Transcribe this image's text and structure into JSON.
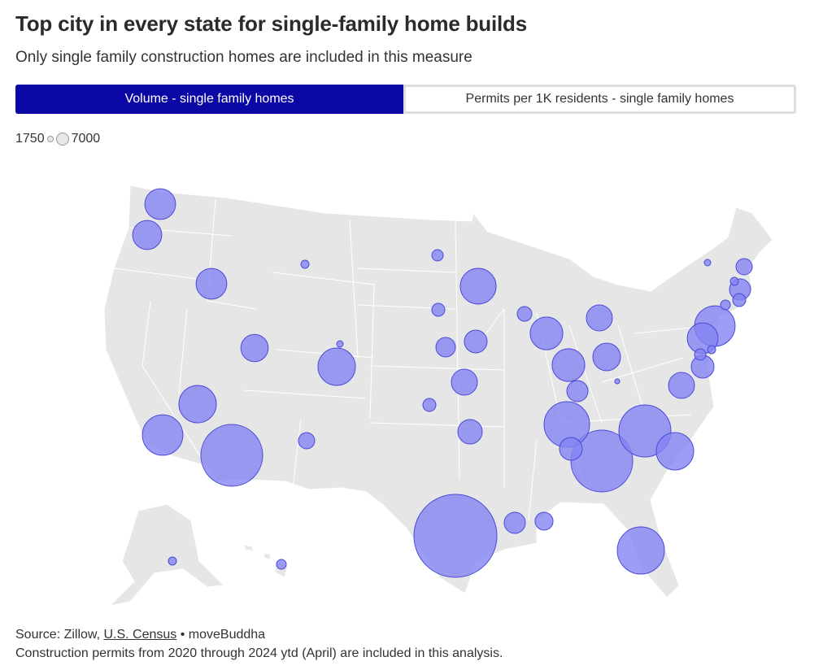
{
  "header": {
    "title": "Top city in every state for single-family home builds",
    "subtitle": "Only single family construction homes are included in this measure"
  },
  "toggle": {
    "options": [
      "Volume - single family homes",
      "Permits per 1K residents - single family homes"
    ],
    "active": 0,
    "active_color": "#0b07a5"
  },
  "legend": {
    "min_label": "1750",
    "max_label": "7000"
  },
  "map": {
    "land_color": "#e6e6e6",
    "bubble_fill": "#8484f4",
    "bubble_stroke": "#4a4ad8",
    "bubbles": [
      {
        "state": "WA",
        "value": 39000
      },
      {
        "state": "OR",
        "value": 35000
      },
      {
        "state": "ID",
        "value": 39000
      },
      {
        "state": "MT",
        "value": 2700
      },
      {
        "state": "UT",
        "value": 31000
      },
      {
        "state": "WY",
        "value": 1750
      },
      {
        "state": "CO",
        "value": 58000
      },
      {
        "state": "NV",
        "value": 58000
      },
      {
        "state": "CA",
        "value": 68000
      },
      {
        "state": "AZ",
        "value": 158000
      },
      {
        "state": "NM",
        "value": 11000
      },
      {
        "state": "ND",
        "value": 5400
      },
      {
        "state": "SD",
        "value": 7000
      },
      {
        "state": "MN",
        "value": 53000
      },
      {
        "state": "NE",
        "value": 15800
      },
      {
        "state": "IA",
        "value": 21400
      },
      {
        "state": "KS",
        "value": 28000
      },
      {
        "state": "OK",
        "value": 7000
      },
      {
        "state": "AR",
        "value": 24600
      },
      {
        "state": "TX",
        "value": 285000
      },
      {
        "state": "LA",
        "value": 18500
      },
      {
        "state": "MS",
        "value": 13200
      },
      {
        "state": "WI",
        "value": 8900
      },
      {
        "state": "IL",
        "value": 44000
      },
      {
        "state": "MI",
        "value": 28000
      },
      {
        "state": "IN",
        "value": 44000
      },
      {
        "state": "OH",
        "value": 31600
      },
      {
        "state": "KY",
        "value": 18500
      },
      {
        "state": "WV",
        "value": 1000
      },
      {
        "state": "TN",
        "value": 86000
      },
      {
        "state": "AL",
        "value": 21400
      },
      {
        "state": "GA",
        "value": 158000
      },
      {
        "state": "SC",
        "value": 58000
      },
      {
        "state": "NC",
        "value": 112000
      },
      {
        "state": "VA",
        "value": 28000
      },
      {
        "state": "FL",
        "value": 92000
      },
      {
        "state": "MD",
        "value": 21400
      },
      {
        "state": "DE",
        "value": 5400
      },
      {
        "state": "DC",
        "value": 2700
      },
      {
        "state": "PA",
        "value": 39000
      },
      {
        "state": "NJ",
        "value": 68000
      },
      {
        "state": "CT",
        "value": 3900
      },
      {
        "state": "RI",
        "value": 7000
      },
      {
        "state": "MA",
        "value": 18500
      },
      {
        "state": "NH",
        "value": 2700
      },
      {
        "state": "ME",
        "value": 11000
      },
      {
        "state": "VT",
        "value": 1750
      },
      {
        "state": "AK",
        "value": 2700
      },
      {
        "state": "HI",
        "value": 3900
      }
    ]
  },
  "footer": {
    "source_prefix": "Source: Zillow, ",
    "source_link": "U.S. Census",
    "source_suffix": " • moveBuddha",
    "note": "Construction permits from 2020 through 2024 ytd (April) are included in this analysis."
  }
}
